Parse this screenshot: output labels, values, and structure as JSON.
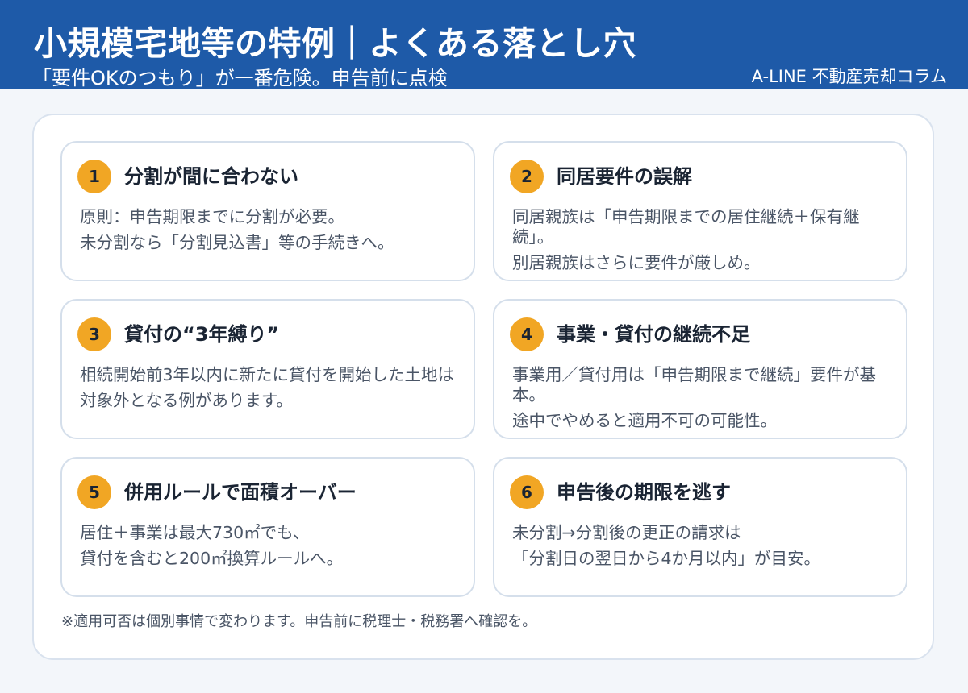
{
  "header": {
    "title": "小規模宅地等の特例｜よくある落とし穴",
    "subtitle": "「要件OKのつもり」が一番危険。申告前に点検",
    "brand": "A-LINE 不動産売却コラム"
  },
  "cards": [
    {
      "number": "1",
      "title": "分割が間に合わない",
      "lines": [
        "原則：申告期限までに分割が必要。",
        "未分割なら「分割見込書」等の手続きへ。"
      ]
    },
    {
      "number": "2",
      "title": "同居要件の誤解",
      "lines": [
        "同居親族は「申告期限までの居住継続＋保有継続」。",
        "別居親族はさらに要件が厳しめ。"
      ]
    },
    {
      "number": "3",
      "title": "貸付の“3年縛り”",
      "lines": [
        "相続開始前3年以内に新たに貸付を開始した土地は",
        "対象外となる例があります。"
      ]
    },
    {
      "number": "4",
      "title": "事業・貸付の継続不足",
      "lines": [
        "事業用／貸付用は「申告期限まで継続」要件が基本。",
        "途中でやめると適用不可の可能性。"
      ]
    },
    {
      "number": "5",
      "title": "併用ルールで面積オーバー",
      "lines": [
        "居住＋事業は最大730㎡でも、",
        "貸付を含むと200㎡換算ルールへ。"
      ]
    },
    {
      "number": "6",
      "title": "申告後の期限を逃す",
      "lines": [
        "未分割→分割後の更正の請求は",
        "「分割日の翌日から4か月以内」が目安。"
      ]
    }
  ],
  "footnote": "※適用可否は個別事情で変わります。申告前に税理士・税務署へ確認を。",
  "colors": {
    "header_bg": "#1e5aa8",
    "badge": "#f1a624",
    "page_bg": "#f3f6fa"
  }
}
